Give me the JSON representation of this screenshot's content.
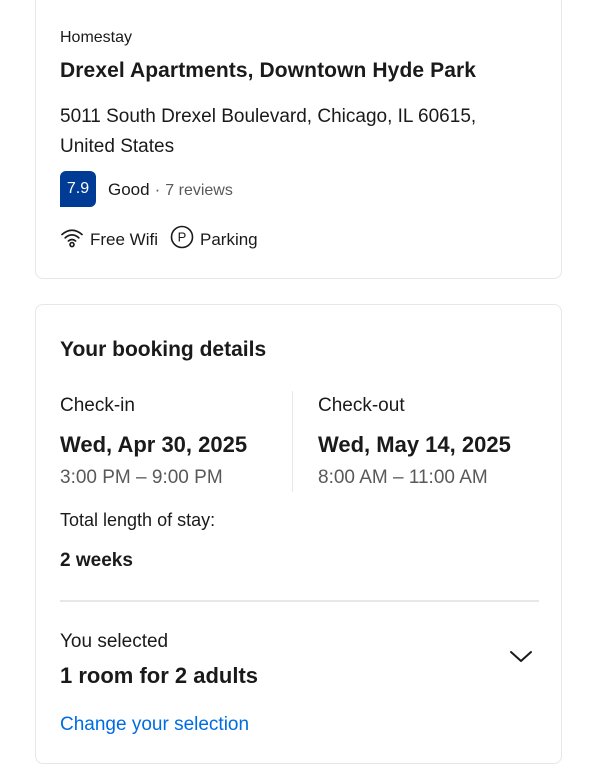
{
  "property": {
    "type": "Homestay",
    "name": "Drexel Apartments, Downtown Hyde Park",
    "address": "5011 South Drexel Boulevard, Chicago, IL 60615, United States",
    "score": "7.9",
    "score_word": "Good",
    "score_separator": "·",
    "reviews": "7 reviews",
    "score_color": "#003b95",
    "amenities": [
      {
        "icon": "wifi-icon",
        "label": "Free Wifi"
      },
      {
        "icon": "parking-icon",
        "label": "Parking"
      }
    ]
  },
  "booking": {
    "title": "Your booking details",
    "checkin": {
      "label": "Check-in",
      "date": "Wed, Apr 30, 2025",
      "time": "3:00 PM – 9:00 PM"
    },
    "checkout": {
      "label": "Check-out",
      "date": "Wed, May 14, 2025",
      "time": "8:00 AM – 11:00 AM"
    },
    "stay_label": "Total length of stay:",
    "stay_value": "2 weeks",
    "selected_label": "You selected",
    "selected_value": "1 room for 2 adults",
    "change_link": "Change your selection",
    "link_color": "#006ce4"
  }
}
